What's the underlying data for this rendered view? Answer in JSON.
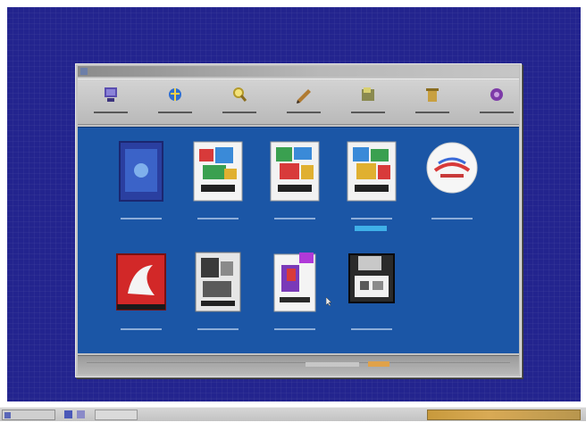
{
  "window": {
    "title": "",
    "toolbar": [
      {
        "label": "",
        "icon": "computer-icon",
        "color": "#5a4db0"
      },
      {
        "label": "",
        "icon": "globe-icon",
        "color": "#2f6fd0"
      },
      {
        "label": "",
        "icon": "search-icon",
        "color": "#d8c44a"
      },
      {
        "label": "",
        "icon": "pencil-icon",
        "color": "#b07a30"
      },
      {
        "label": "",
        "icon": "folder-icon",
        "color": "#8a8a50"
      },
      {
        "label": "",
        "icon": "trash-icon",
        "color": "#c8a040"
      },
      {
        "label": "",
        "icon": "settings-icon",
        "color": "#7d3aa8"
      }
    ],
    "items": [
      {
        "caption": "",
        "icon": "blue-document-icon"
      },
      {
        "caption": "",
        "icon": "colorful-package-icon"
      },
      {
        "caption": "",
        "icon": "colorful-package-icon"
      },
      {
        "caption": "",
        "icon": "colorful-package-icon",
        "tag": ""
      },
      {
        "caption": "",
        "icon": "round-badge-icon"
      },
      {
        "caption": "",
        "icon": "red-app-icon"
      },
      {
        "caption": "",
        "icon": "gray-package-icon"
      },
      {
        "caption": "",
        "icon": "document-package-icon"
      },
      {
        "caption": "",
        "icon": "floppy-disk-icon"
      }
    ]
  },
  "taskbar": {
    "start_label": "",
    "task_label": "",
    "tray_text": ""
  },
  "colors": {
    "desktop": "#23248e",
    "content": "#1b56a6",
    "highlight_tag": "#3fb0e8",
    "tray": "#d9aa55"
  }
}
